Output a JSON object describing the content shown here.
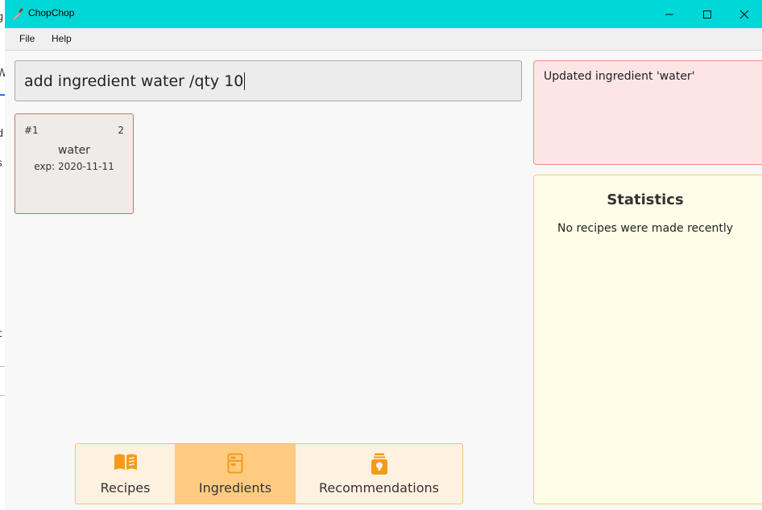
{
  "window": {
    "title": "ChopChop"
  },
  "menu": [
    "File",
    "Help"
  ],
  "command": {
    "value": "add ingredient water /qty 10"
  },
  "ingredients": [
    {
      "index": "#1",
      "quantity": "2",
      "name": "water",
      "expiry": "exp: 2020-11-11"
    }
  ],
  "result": {
    "message": "Updated ingredient 'water'"
  },
  "statistics": {
    "title": "Statistics",
    "message": "No recipes were made recently"
  },
  "tabs": [
    {
      "label": "Recipes",
      "icon": "book-icon",
      "active": false
    },
    {
      "label": "Ingredients",
      "icon": "fridge-icon",
      "active": true
    },
    {
      "label": "Recommendations",
      "icon": "lightbulb-jar-icon",
      "active": false
    }
  ],
  "background_fragments": [
    "g",
    "W",
    "d",
    "i",
    "s",
    "c",
    "i"
  ],
  "colors": {
    "titlebar": "#00d8d8",
    "accent": "#f29b1d",
    "result_bg": "#fde5e5",
    "stats_bg": "#fffde8",
    "tab_active": "#ffcb80"
  }
}
